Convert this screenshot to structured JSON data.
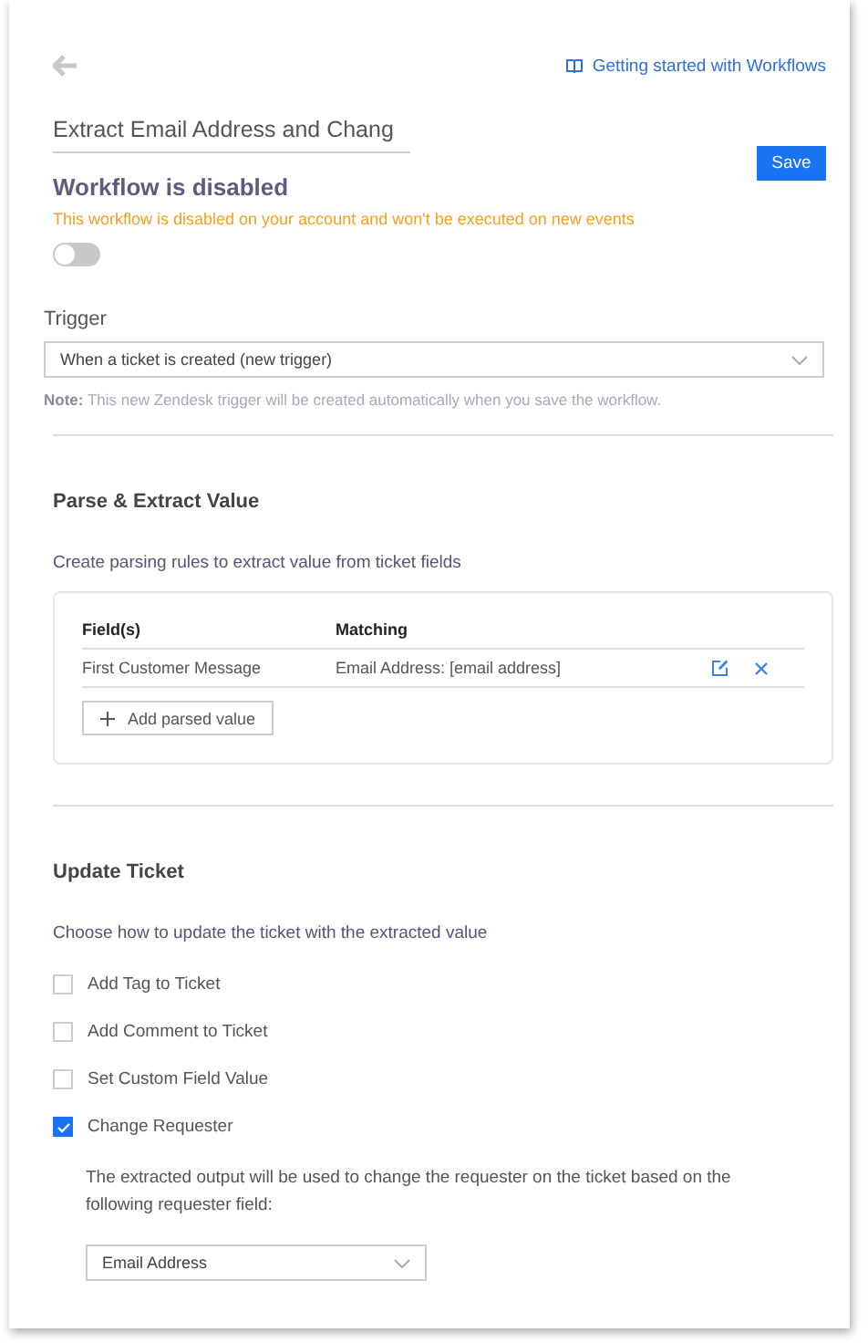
{
  "header": {
    "help_link": "Getting started with Workflows"
  },
  "title_field": {
    "value": "Extract Email Address and Chang"
  },
  "save_button": "Save",
  "status": {
    "heading": "Workflow is disabled",
    "warning": "This workflow is disabled on your account and won't be executed on new events",
    "on": false
  },
  "trigger": {
    "label": "Trigger",
    "value": "When a ticket is created (new trigger)",
    "note": "**Note:** This new Zendesk trigger will be created automatically when you save the workflow."
  },
  "parse_section": {
    "heading": "Parse & Extract Value",
    "description": "Create parsing rules to extract value from ticket fields",
    "table": {
      "columns": [
        "Field(s)",
        "Matching"
      ],
      "rows": [
        {
          "field": "First Customer Message",
          "matching": "Email Address: [email address]"
        }
      ]
    },
    "add_button": "Add parsed value"
  },
  "update_section": {
    "heading": "Update Ticket",
    "description": "Choose how to update the ticket with the extracted value",
    "options": [
      {
        "label": "Add Tag to Ticket",
        "checked": false
      },
      {
        "label": "Add Comment to Ticket",
        "checked": false
      },
      {
        "label": "Set Custom Field Value",
        "checked": false
      },
      {
        "label": "Change Requester",
        "checked": true
      }
    ],
    "requester_note": "The extracted output will be used to change the requester on the ticket based on the following requester field:",
    "requester_field": "Email Address"
  }
}
